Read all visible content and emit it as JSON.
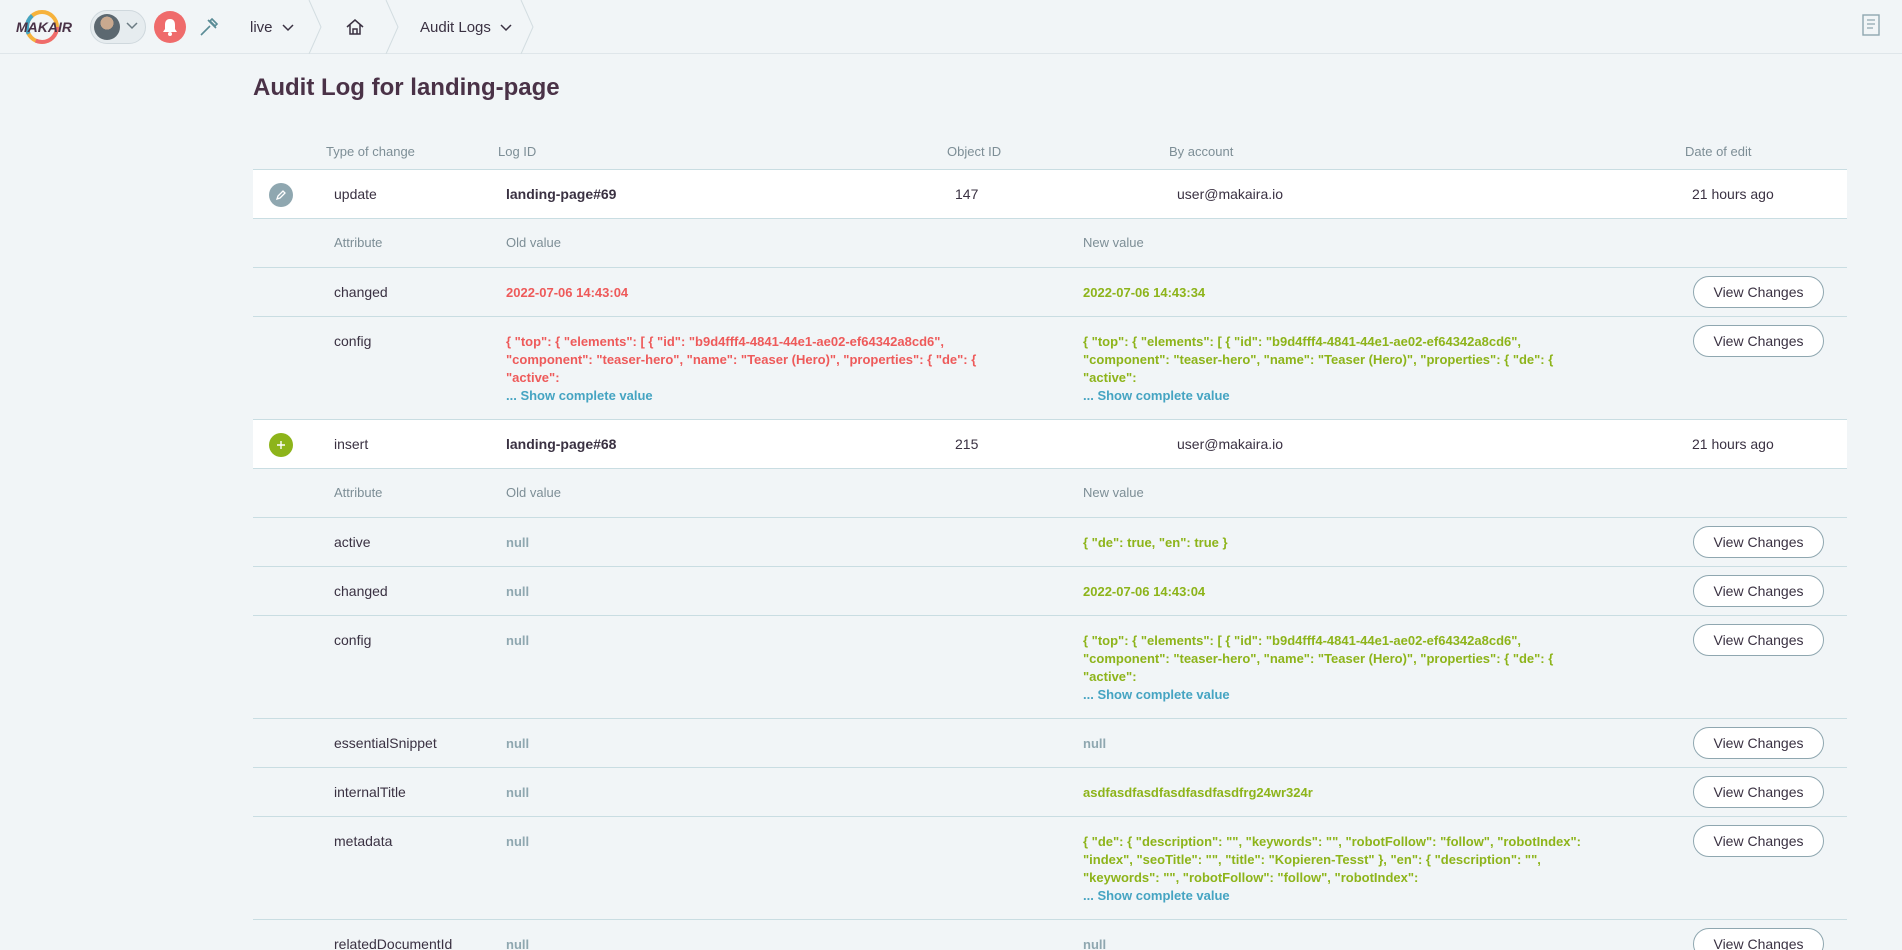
{
  "topbar": {
    "crumb_live": "live",
    "crumb_audit": "Audit Logs"
  },
  "page": {
    "title": "Audit Log for landing-page"
  },
  "columns": {
    "type": "Type of change",
    "log_id": "Log ID",
    "object_id": "Object ID",
    "account": "By account",
    "date": "Date of edit"
  },
  "subcolumns": {
    "attribute": "Attribute",
    "old": "Old value",
    "new": "New value"
  },
  "view_changes_label": "View Changes",
  "show_more_label": "... Show complete value",
  "entries": [
    {
      "type": "update",
      "log_id": "landing-page#69",
      "object_id": "147",
      "account": "user@makaira.io",
      "date": "21 hours ago",
      "changes": [
        {
          "attribute": "changed",
          "old": "2022-07-06 14:43:04",
          "new": "2022-07-06 14:43:34"
        },
        {
          "attribute": "config",
          "old": "{ \"top\": { \"elements\": [ { \"id\": \"b9d4fff4-4841-44e1-ae02-ef64342a8cd6\", \"component\": \"teaser-hero\", \"name\": \"Teaser (Hero)\", \"properties\": { \"de\": { \"active\":",
          "new": "{ \"top\": { \"elements\": [ { \"id\": \"b9d4fff4-4841-44e1-ae02-ef64342a8cd6\", \"component\": \"teaser-hero\", \"name\": \"Teaser (Hero)\", \"properties\": { \"de\": { \"active\":"
        }
      ]
    },
    {
      "type": "insert",
      "log_id": "landing-page#68",
      "object_id": "215",
      "account": "user@makaira.io",
      "date": "21 hours ago",
      "changes": [
        {
          "attribute": "active",
          "old": "null",
          "new": "{ \"de\": true, \"en\": true }"
        },
        {
          "attribute": "changed",
          "old": "null",
          "new": "2022-07-06 14:43:04"
        },
        {
          "attribute": "config",
          "old": "null",
          "new": "{ \"top\": { \"elements\": [ { \"id\": \"b9d4fff4-4841-44e1-ae02-ef64342a8cd6\", \"component\": \"teaser-hero\", \"name\": \"Teaser (Hero)\", \"properties\": { \"de\": { \"active\":"
        },
        {
          "attribute": "essentialSnippet",
          "old": "null",
          "new": "null"
        },
        {
          "attribute": "internalTitle",
          "old": "null",
          "new": "asdfasdfasdfasdfasdfasdfrg24wr324r"
        },
        {
          "attribute": "metadata",
          "old": "null",
          "new": "{ \"de\": { \"description\": \"\", \"keywords\": \"\", \"robotFollow\": \"follow\", \"robotIndex\": \"index\", \"seoTitle\": \"\", \"title\": \"Kopieren-Tesst\" }, \"en\": { \"description\": \"\", \"keywords\": \"\", \"robotFollow\": \"follow\", \"robotIndex\":"
        },
        {
          "attribute": "relatedDocumentId",
          "old": "null",
          "new": "null"
        }
      ]
    }
  ]
}
